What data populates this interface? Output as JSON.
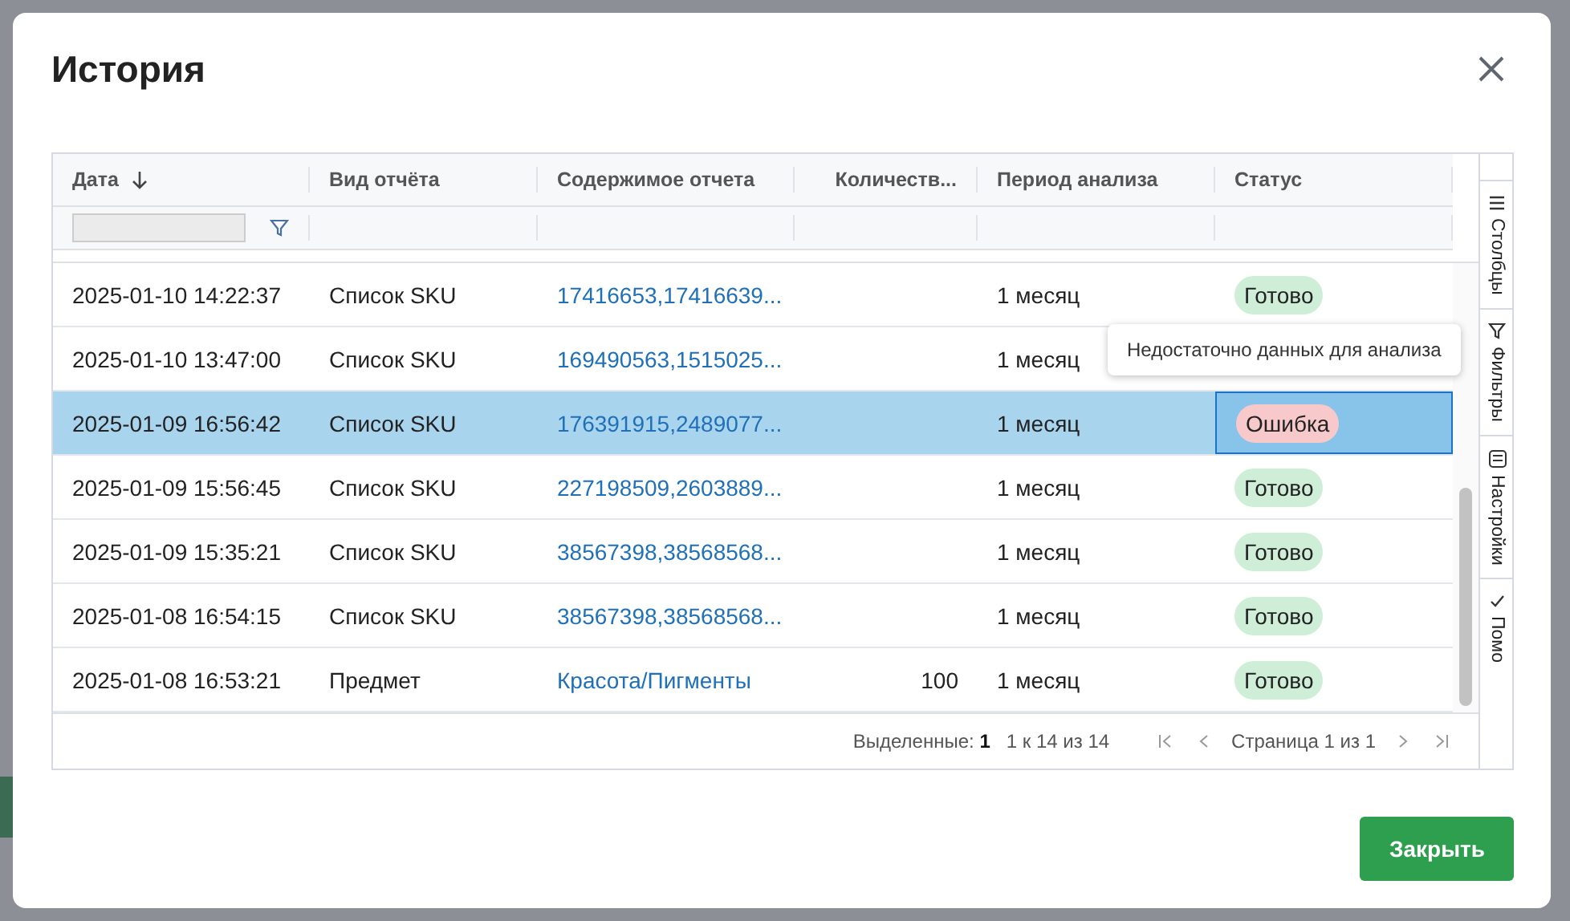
{
  "dialog": {
    "title": "История"
  },
  "table": {
    "columns": [
      {
        "label": "Дата",
        "sorted_desc": true
      },
      {
        "label": "Вид отчёта"
      },
      {
        "label": "Содержимое отчета"
      },
      {
        "label": "Количеств..."
      },
      {
        "label": "Период анализа"
      },
      {
        "label": "Статус"
      }
    ],
    "rows": [
      {
        "date": "2025-01-10 14:22:37",
        "type": "Список SKU",
        "content": "17416653,17416639...",
        "count": "",
        "period": "1 месяц",
        "status": {
          "label": "Готово",
          "kind": "ok"
        },
        "selected": false
      },
      {
        "date": "2025-01-10 13:47:00",
        "type": "Список SKU",
        "content": "169490563,1515025...",
        "count": "",
        "period": "1 месяц",
        "status": null,
        "selected": false
      },
      {
        "date": "2025-01-09 16:56:42",
        "type": "Список SKU",
        "content": "176391915,2489077...",
        "count": "",
        "period": "1 месяц",
        "status": {
          "label": "Ошибка",
          "kind": "error"
        },
        "selected": true
      },
      {
        "date": "2025-01-09 15:56:45",
        "type": "Список SKU",
        "content": "227198509,2603889...",
        "count": "",
        "period": "1 месяц",
        "status": {
          "label": "Готово",
          "kind": "ok"
        },
        "selected": false
      },
      {
        "date": "2025-01-09 15:35:21",
        "type": "Список SKU",
        "content": "38567398,38568568...",
        "count": "",
        "period": "1 месяц",
        "status": {
          "label": "Готово",
          "kind": "ok"
        },
        "selected": false
      },
      {
        "date": "2025-01-08 16:54:15",
        "type": "Список SKU",
        "content": "38567398,38568568...",
        "count": "",
        "period": "1 месяц",
        "status": {
          "label": "Готово",
          "kind": "ok"
        },
        "selected": false
      },
      {
        "date": "2025-01-08 16:53:21",
        "type": "Предмет",
        "content": "Красота/Пигменты",
        "count": "100",
        "period": "1 месяц",
        "status": {
          "label": "Готово",
          "kind": "ok"
        },
        "selected": false
      }
    ],
    "tooltip": "Недостаточно данных для анализа",
    "side_tabs": [
      {
        "label": "Столбцы",
        "kind": "columns"
      },
      {
        "label": "Фильтры",
        "kind": "filter"
      },
      {
        "label": "Настройки",
        "kind": "settings"
      },
      {
        "label": "Помо",
        "kind": "check"
      }
    ],
    "footer": {
      "selected_label": "Выделенные:",
      "selected_count": "1",
      "range": "1 к 14 из 14",
      "page": "Страница 1 из 1"
    }
  },
  "buttons": [
    {
      "label": "Закрыть"
    }
  ]
}
